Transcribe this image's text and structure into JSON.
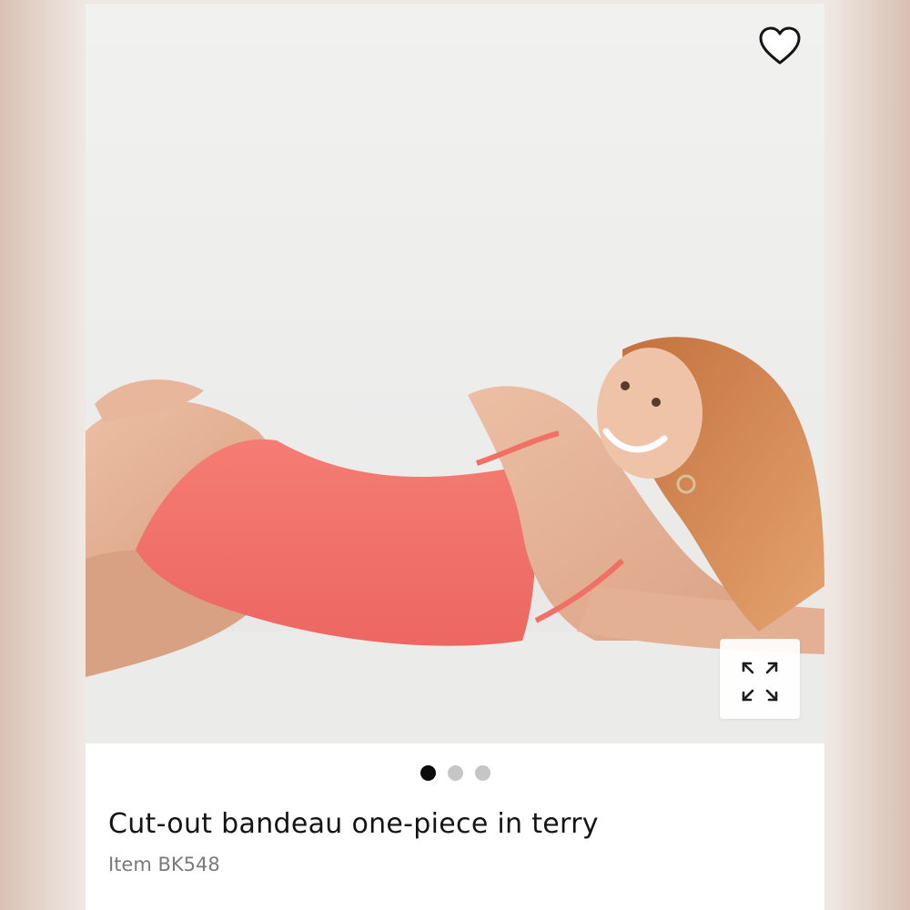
{
  "product": {
    "title": "Cut-out bandeau one-piece in terry",
    "item_label": "Item",
    "item_code": "BK548",
    "image_alt": "Model wearing coral pink terry one-piece swimsuit"
  },
  "carousel": {
    "total": 3,
    "active_index": 0
  },
  "icons": {
    "favorite": "heart-outline-icon",
    "expand": "expand-arrows-icon"
  },
  "colors": {
    "swimsuit": "#f2716c",
    "active_dot": "#0b0b0b",
    "inactive_dot": "#c6c6c6",
    "title_text": "#141414",
    "item_text": "#7a7a7a"
  }
}
